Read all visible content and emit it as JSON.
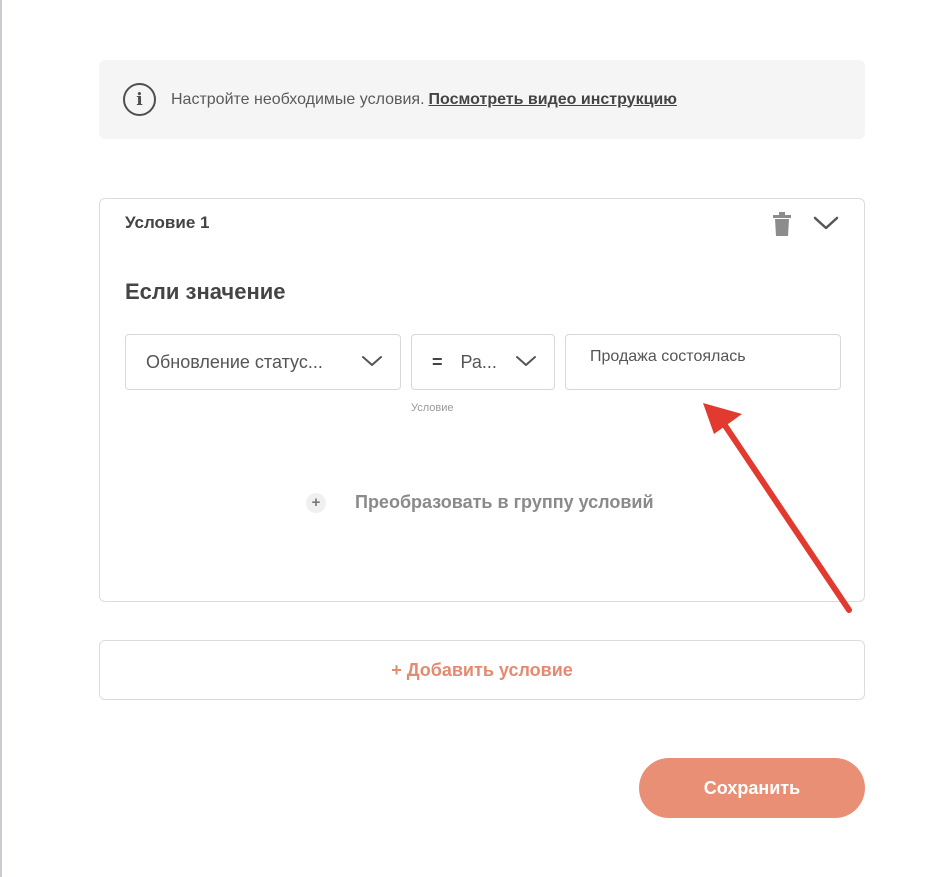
{
  "banner": {
    "icon": "info-icon",
    "icon_glyph": "i",
    "text": "Настройте необходимые условия.",
    "link": "Посмотреть видео инструкцию"
  },
  "condition": {
    "title": "Условие 1",
    "heading": "Если значение",
    "field_select": {
      "value": "Обновление статус..."
    },
    "operator_select": {
      "symbol": "=",
      "value": "Ра..."
    },
    "value_input": {
      "value": "Продажа состоялась"
    },
    "operator_label": "Условие",
    "group_action": {
      "plus": "+",
      "label": "Преобразовать в группу условий"
    }
  },
  "add_condition_label": "+ Добавить условие",
  "save_label": "Сохранить",
  "colors": {
    "accent": "#e88f76",
    "accent_text": "#e58a70",
    "annotation_arrow": "#e23a2f"
  }
}
